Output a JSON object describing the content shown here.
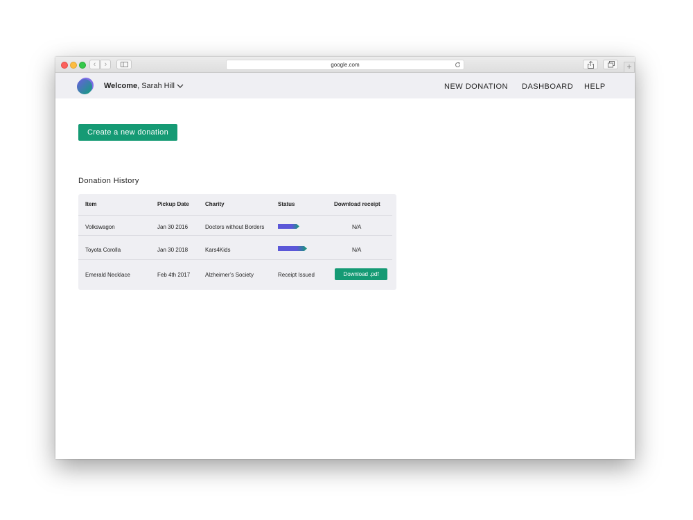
{
  "browser": {
    "url": "google.com"
  },
  "header": {
    "welcome_bold": "Welcome",
    "welcome_rest": ", Sarah Hill",
    "nav": [
      "NEW DONATION",
      "DASHBOARD",
      "HELP"
    ]
  },
  "main": {
    "create_button": "Create a new donation",
    "history_title": "Donation History",
    "table": {
      "columns": [
        "Item",
        "Pickup Date",
        "Charity",
        "Status",
        "Download receipt"
      ],
      "rows": [
        {
          "item": "Volkswagon",
          "pickup_date": "Jan 30 2016",
          "charity": "Doctors without Borders",
          "status_progress": 0.6,
          "receipt": "N/A"
        },
        {
          "item": "Toyota Corolla",
          "pickup_date": "Jan 30 2018",
          "charity": "Kars4Kids",
          "status_progress": 0.8,
          "receipt": "N/A"
        },
        {
          "item": "Emerald Necklace",
          "pickup_date": "Feb 4th 2017",
          "charity": "Alzheimer’s Society",
          "status": "Receipt Issued",
          "receipt_button": "Download .pdf"
        }
      ]
    }
  },
  "colors": {
    "accent": "#159a74",
    "status_start": "#5b57d8",
    "status_end": "#159a74",
    "header_bg": "#efeff3"
  },
  "icons": [
    "back-icon",
    "forward-icon",
    "sidebar-icon",
    "reload-icon",
    "share-icon",
    "tabs-icon",
    "plus-icon",
    "chevron-down-icon"
  ]
}
